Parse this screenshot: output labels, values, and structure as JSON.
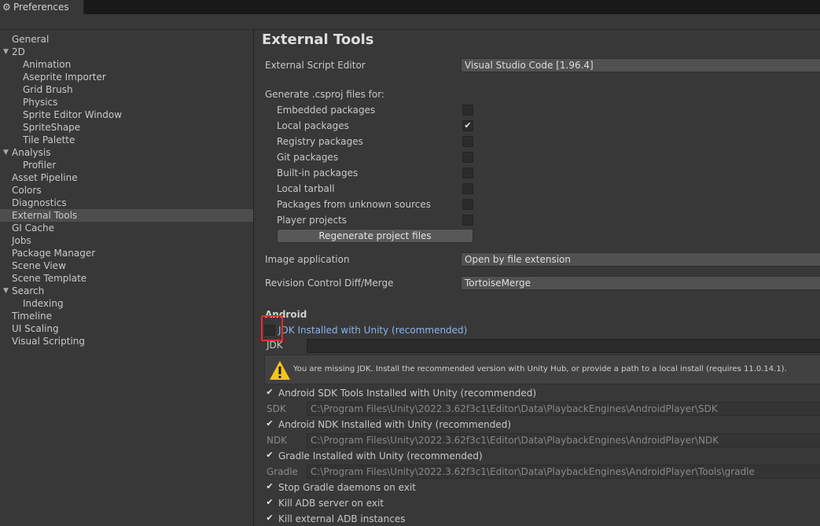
{
  "window": {
    "tab_title": "Preferences"
  },
  "sidebar": {
    "items": [
      {
        "label": "General"
      },
      {
        "label": "2D"
      },
      {
        "label": "Animation"
      },
      {
        "label": "Aseprite Importer"
      },
      {
        "label": "Grid Brush"
      },
      {
        "label": "Physics"
      },
      {
        "label": "Sprite Editor Window"
      },
      {
        "label": "SpriteShape"
      },
      {
        "label": "Tile Palette"
      },
      {
        "label": "Analysis"
      },
      {
        "label": "Profiler"
      },
      {
        "label": "Asset Pipeline"
      },
      {
        "label": "Colors"
      },
      {
        "label": "Diagnostics"
      },
      {
        "label": "External Tools"
      },
      {
        "label": "GI Cache"
      },
      {
        "label": "Jobs"
      },
      {
        "label": "Package Manager"
      },
      {
        "label": "Scene View"
      },
      {
        "label": "Scene Template"
      },
      {
        "label": "Search"
      },
      {
        "label": "Indexing"
      },
      {
        "label": "Timeline"
      },
      {
        "label": "UI Scaling"
      },
      {
        "label": "Visual Scripting"
      }
    ],
    "selected": "External Tools"
  },
  "main": {
    "title": "External Tools",
    "script_editor_label": "External Script Editor",
    "script_editor_value": "Visual Studio Code [1.96.4]",
    "generate_label": "Generate .csproj files for:",
    "csproj_options": [
      {
        "label": "Embedded packages",
        "checked": false
      },
      {
        "label": "Local packages",
        "checked": true
      },
      {
        "label": "Registry packages",
        "checked": false
      },
      {
        "label": "Git packages",
        "checked": false
      },
      {
        "label": "Built-in packages",
        "checked": false
      },
      {
        "label": "Local tarball",
        "checked": false
      },
      {
        "label": "Packages from unknown sources",
        "checked": false
      },
      {
        "label": "Player projects",
        "checked": false
      }
    ],
    "regenerate_label": "Regenerate project files",
    "image_app_label": "Image application",
    "image_app_value": "Open by file extension",
    "revision_label": "Revision Control Diff/Merge",
    "revision_value": "TortoiseMerge"
  },
  "android": {
    "header": "Android",
    "jdk_checkbox_label": "JDK Installed with Unity (recommended)",
    "jdk_label": "JDK",
    "jdk_value": "",
    "warning": "You are missing JDK. Install the recommended version with Unity Hub, or provide a path to a local install (requires 11.0.14.1).",
    "sdk_checkbox_label": "Android SDK Tools Installed with Unity (recommended)",
    "sdk_label": "SDK",
    "sdk_value": "C:\\Program Files\\Unity\\2022.3.62f3c1\\Editor\\Data\\PlaybackEngines\\AndroidPlayer\\SDK",
    "ndk_checkbox_label": "Android NDK Installed with Unity (recommended)",
    "ndk_label": "NDK",
    "ndk_value": "C:\\Program Files\\Unity\\2022.3.62f3c1\\Editor\\Data\\PlaybackEngines\\AndroidPlayer\\NDK",
    "gradle_checkbox_label": "Gradle Installed with Unity (recommended)",
    "gradle_label": "Gradle",
    "gradle_value": "C:\\Program Files\\Unity\\2022.3.62f3c1\\Editor\\Data\\PlaybackEngines\\AndroidPlayer\\Tools\\gradle",
    "stop_gradle_label": "Stop Gradle daemons on exit",
    "kill_adb_label": "Kill ADB server on exit",
    "kill_external_adb_label": "Kill external ADB instances"
  },
  "icons": {
    "gear": "gear-icon",
    "foldout": "triangle-down-icon",
    "check": "checkmark-icon",
    "warning": "warning-icon"
  },
  "colors": {
    "background": "#383838",
    "selection": "#4d4d4d",
    "highlight_box": "#e0302a",
    "link_blue": "#8ab4f0",
    "warning_yellow": "#f5c518"
  }
}
